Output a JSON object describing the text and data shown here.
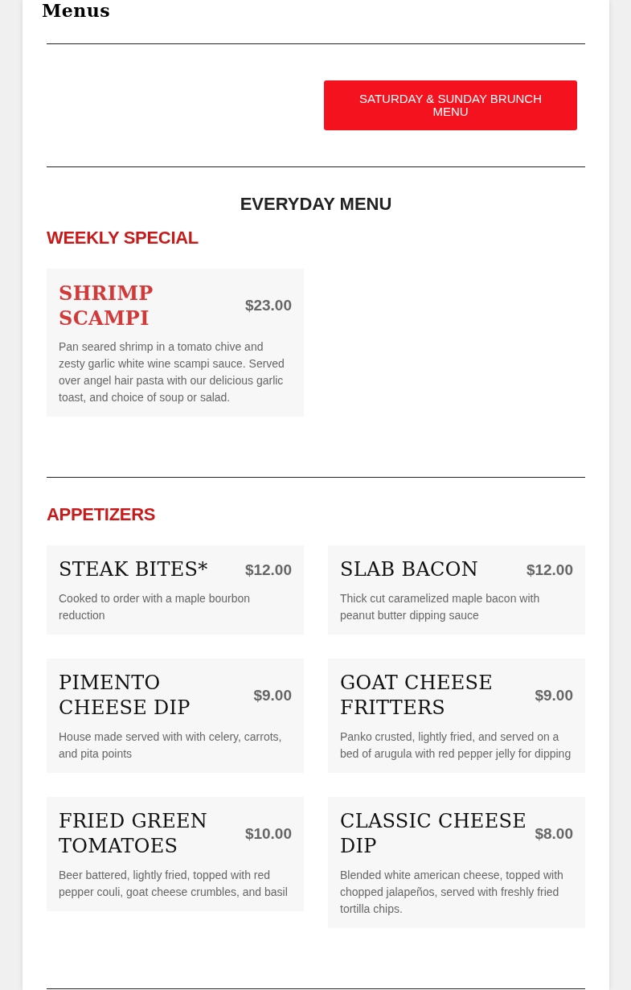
{
  "page_title": "Menus",
  "brunch_button": "SATURDAY & SUNDAY BRUNCH MENU",
  "menu_title": "EVERYDAY MENU",
  "sections": [
    {
      "title": "WEEKLY SPECIAL",
      "items": [
        {
          "kind": "special",
          "name": "SHRIMP SCAMPI",
          "price": "$23.00",
          "description": "Pan seared shrimp in a tomato chive and zesty garlic white wine scampi sauce. Served over angel hair pasta with our delicious garlic toast, and choice of soup or salad."
        }
      ]
    },
    {
      "title": "APPETIZERS",
      "items": [
        {
          "kind": "regular",
          "name": "STEAK BITES*",
          "price": "$12.00",
          "description": "Cooked to order with a maple bourbon reduction"
        },
        {
          "kind": "regular",
          "name": "SLAB BACON",
          "price": "$12.00",
          "description": "Thick cut caramelized maple bacon with peanut butter dipping sauce"
        },
        {
          "kind": "regular",
          "name": "PIMENTO CHEESE DIP",
          "price": "$9.00",
          "description": "House made served with with celery, carrots, and pita points"
        },
        {
          "kind": "regular",
          "name": "GOAT CHEESE FRITTERS",
          "price": "$9.00",
          "description": "Panko crusted, lightly fried, and served on a bed of arugula with red pepper jelly for dipping"
        },
        {
          "kind": "regular",
          "name": "FRIED GREEN TOMATOES",
          "price": "$10.00",
          "description": "Beer battered, lightly fried, topped with red pepper couli, goat cheese crumbles, and basil"
        },
        {
          "kind": "regular",
          "name": "CLASSIC CHEESE DIP",
          "price": "$8.00",
          "description": "Blended white american cheese, topped with chopped jalapeños, served with freshly fried tortilla chips."
        }
      ]
    }
  ]
}
